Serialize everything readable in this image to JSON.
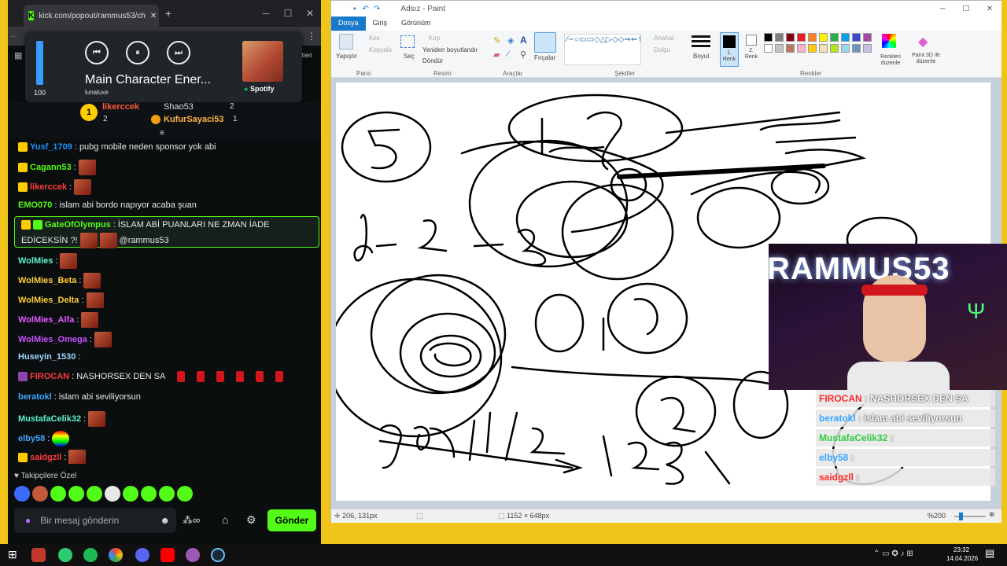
{
  "kick": {
    "tab_title": "kick.com/popout/rammus53/ch",
    "tab_close": "✕",
    "new_tab": "+",
    "addr_right": "aretleri",
    "media": {
      "volume_value": 100,
      "volume_label": "100",
      "track_title": "Main Character Ener...",
      "artist": "lunaluxe",
      "source": "Spotify"
    },
    "gifters": [
      {
        "name": "likerccek",
        "count": "2"
      },
      {
        "name": "Shao53",
        "count": "2"
      },
      {
        "name": "KufurSayaci53",
        "count": "1"
      }
    ],
    "chat": [
      {
        "user": "Yusf_1709",
        "text": ": pubg mobile neden sponsor yok abi",
        "color": "#1e90ff"
      },
      {
        "user": "Cagann53",
        "text": ":",
        "color": "#53fc18"
      },
      {
        "user": "likerccek",
        "text": ":",
        "color": "#ff3b3b"
      },
      {
        "user": "EMO070",
        "text": ": islam abi bordo napıyor acaba şuan",
        "color": "#53fc18"
      },
      {
        "user": "GateOfOlympus",
        "text": ": İSLAM ABİ PUANLARI NE ZMAN İADE",
        "text2": "EDİCEKSİN ?!",
        "mention": "@rammus53",
        "color": "#53fc18"
      },
      {
        "user": "WolMies",
        "text": ":",
        "color": "#5ff2c9"
      },
      {
        "user": "WolMies_Beta",
        "text": ":",
        "color": "#ffce3b"
      },
      {
        "user": "WolMies_Delta",
        "text": ":",
        "color": "#ffce3b"
      },
      {
        "user": "WolMies_Alfa",
        "text": ":",
        "color": "#e05bff"
      },
      {
        "user": "WolMies_Omega",
        "text": ":",
        "color": "#c650ff"
      },
      {
        "user": "Huseyin_1530",
        "text": ":",
        "color": "#9ad7ff"
      },
      {
        "user": "FIROCAN",
        "text": ": NASHORSEX DEN SA",
        "color": "#ff3b3b"
      },
      {
        "user": "beratokl",
        "text": ": islam abi seviliyorsun",
        "color": "#3ba7ff"
      },
      {
        "user": "MustafaCelik32",
        "text": ":",
        "color": "#5ff2c9"
      },
      {
        "user": "elby58",
        "text": ":",
        "color": "#3ba7ff"
      },
      {
        "user": "saidgzll",
        "text": ":",
        "color": "#ff3b3b"
      }
    ],
    "followers_label": "Takipçilere Özel",
    "input_placeholder": "Bir mesaj gönderin",
    "send_label": "Gönder"
  },
  "paint": {
    "title": "Adsız - Paint",
    "tabs": [
      "Dosya",
      "Giriş",
      "Görünüm"
    ],
    "ribbon": {
      "paste": "Yapıştır",
      "cut": "Kes",
      "copy": "Kopyala",
      "select": "Seç",
      "crop": "Kırp",
      "resize": "Yeniden boyutlandır",
      "rotate": "Döndür",
      "brushes": "Fırçalar",
      "outline": "Anahat",
      "fill": "Dolgu",
      "size": "Boyut",
      "color1": "1. Renk",
      "color2": "2. Renk",
      "edit_colors": "Renkleri düzenle",
      "paint3d": "Paint 3D ile düzenle"
    },
    "groups": [
      "Pano",
      "Resim",
      "Araçlar",
      "Şekiller",
      "Renkler"
    ],
    "palette": [
      "#000000",
      "#7f7f7f",
      "#880015",
      "#ed1c24",
      "#ff7f27",
      "#fff200",
      "#22b14c",
      "#00a2e8",
      "#3f48cc",
      "#a349a4",
      "#ffffff",
      "#c3c3c3",
      "#b97a57",
      "#ffaec9",
      "#ffc90e",
      "#efe4b0",
      "#b5e61d",
      "#99d9ea",
      "#7092be",
      "#c8bfe7"
    ],
    "status": {
      "cursor": "206, 131px",
      "size": "1152 × 648px",
      "zoom": "%200"
    }
  },
  "overlay": {
    "cam_text": "RAMMUS53",
    "rows": [
      {
        "user": "FIROCAN",
        "text": ": NASHORSEX DEN SA",
        "color": "#ff2a2a"
      },
      {
        "user": "beratokl",
        "text": ": islam abi seviliyorsun",
        "color": "#3ba7ff"
      },
      {
        "user": "MustafaCelik32",
        "text": ":",
        "color": "#2ecc40"
      },
      {
        "user": "elby58",
        "text": ":",
        "color": "#3ba7ff"
      },
      {
        "user": "saidgzll",
        "text": ":",
        "color": "#ff2a2a"
      }
    ]
  },
  "taskbar": {
    "time": "23:32",
    "date": "14.04.2026"
  }
}
